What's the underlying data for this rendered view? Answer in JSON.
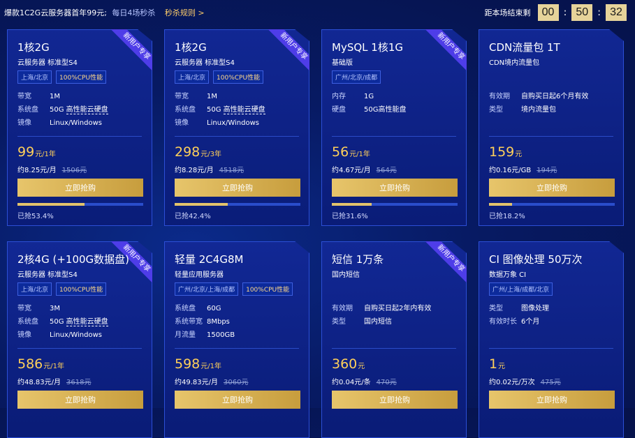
{
  "topbar": {
    "promo_main": "爆款1C2G云服务器首年99元;",
    "promo_sub": "每日4场秒杀",
    "promo_link": "秒杀规则 >",
    "countdown_label": "距本场结束剩",
    "hh": "00",
    "mm": "50",
    "ss": "32"
  },
  "cards": [
    {
      "ribbon": "新用户专享",
      "title": "1核2G",
      "subtitle": "云服务器 标准型S4",
      "tags": [
        {
          "text": "上海/北京"
        },
        {
          "text": "100%CPU性能",
          "hi": true
        }
      ],
      "specs": [
        {
          "k": "带宽",
          "v": "1M"
        },
        {
          "k": "系统盘",
          "v": "50G 高性能云硬盘"
        },
        {
          "k": "镜像",
          "v": "Linux/Windows"
        }
      ],
      "price": "99",
      "price_unit": "元/1年",
      "per": "约8.25元/月",
      "old": "1506元",
      "buy": "立即抢购",
      "sold_ratio": 0.534,
      "sold": "已抢53.4%"
    },
    {
      "ribbon": "新用户专享",
      "title": "1核2G",
      "subtitle": "云服务器 标准型S4",
      "tags": [
        {
          "text": "上海/北京"
        },
        {
          "text": "100%CPU性能",
          "hi": true
        }
      ],
      "specs": [
        {
          "k": "带宽",
          "v": "1M"
        },
        {
          "k": "系统盘",
          "v": "50G 高性能云硬盘"
        },
        {
          "k": "镜像",
          "v": "Linux/Windows"
        }
      ],
      "price": "298",
      "price_unit": "元/3年",
      "per": "约8.28元/月",
      "old": "4518元",
      "buy": "立即抢购",
      "sold_ratio": 0.424,
      "sold": "已抢42.4%"
    },
    {
      "ribbon": "新用户专享",
      "title": "MySQL 1核1G",
      "subtitle": "基础版",
      "tags": [
        {
          "text": "广州/北京/成都"
        }
      ],
      "specs": [
        {
          "k": "内存",
          "v": "1G"
        },
        {
          "k": "硬盘",
          "v": "50G高性能盘"
        }
      ],
      "price": "56",
      "price_unit": "元/1年",
      "per": "约4.67元/月",
      "old": "564元",
      "buy": "立即抢购",
      "sold_ratio": 0.316,
      "sold": "已抢31.6%"
    },
    {
      "title": "CDN流量包 1T",
      "subtitle": "CDN境内流量包",
      "tags": [],
      "specs": [
        {
          "k": "有效期",
          "v": "自购买日起6个月有效"
        },
        {
          "k": "类型",
          "v": "境内流量包"
        }
      ],
      "price": "159",
      "price_unit": "元",
      "per": "约0.16元/GB",
      "old": "194元",
      "buy": "立即抢购",
      "sold_ratio": 0.182,
      "sold": "已抢18.2%"
    },
    {
      "ribbon": "新用户专享",
      "title": "2核4G (+100G数据盘)",
      "subtitle": "云服务器 标准型S4",
      "tags": [
        {
          "text": "上海/北京"
        },
        {
          "text": "100%CPU性能",
          "hi": true
        }
      ],
      "specs": [
        {
          "k": "带宽",
          "v": "3M"
        },
        {
          "k": "系统盘",
          "v": "50G 高性能云硬盘"
        },
        {
          "k": "镜像",
          "v": "Linux/Windows"
        }
      ],
      "price": "586",
      "price_unit": "元/1年",
      "per": "约48.83元/月",
      "old": "3618元",
      "buy": "立即抢购"
    },
    {
      "title": "轻量 2C4G8M",
      "subtitle": "轻量应用服务器",
      "tags": [
        {
          "text": "广州/北京/上海/成都"
        },
        {
          "text": "100%CPU性能",
          "hi": true
        }
      ],
      "specs": [
        {
          "k": "系统盘",
          "v": "60G"
        },
        {
          "k": "系统带宽",
          "v": "8Mbps"
        },
        {
          "k": "月流量",
          "v": "1500GB"
        }
      ],
      "price": "598",
      "price_unit": "元/1年",
      "per": "约49.83元/月",
      "old": "3060元",
      "buy": "立即抢购"
    },
    {
      "ribbon": "新用户专享",
      "title": "短信 1万条",
      "subtitle": "国内短信",
      "tags": [],
      "specs": [
        {
          "k": "有效期",
          "v": "自购买日起2年内有效"
        },
        {
          "k": "类型",
          "v": "国内短信"
        }
      ],
      "price": "360",
      "price_unit": "元",
      "per": "约0.04元/条",
      "old": "470元",
      "buy": "立即抢购"
    },
    {
      "title": "CI 图像处理 50万次",
      "subtitle": "数据万象 CI",
      "tags": [
        {
          "text": "广州/上海/成都/北京"
        }
      ],
      "specs": [
        {
          "k": "类型",
          "v": "图像处理"
        },
        {
          "k": "有效时长",
          "v": "6个月"
        }
      ],
      "price": "1",
      "price_unit": "元",
      "per": "约0.02元/万次",
      "old": "475元",
      "buy": "立即抢购"
    }
  ]
}
